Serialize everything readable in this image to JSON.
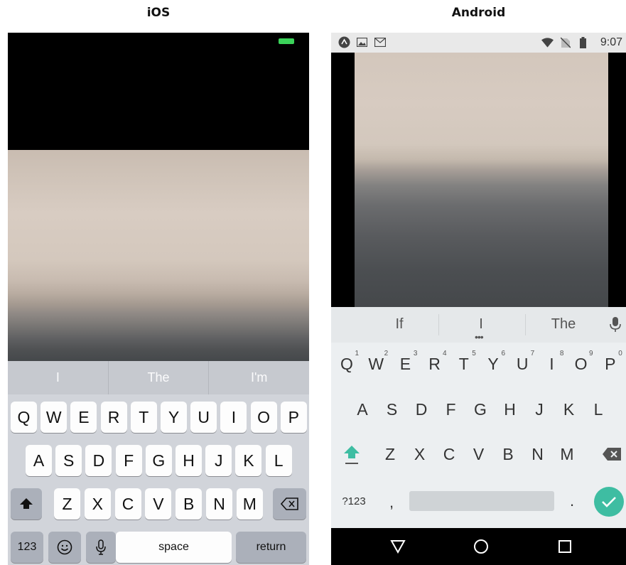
{
  "headings": {
    "ios": "iOS",
    "android": "Android"
  },
  "colors": {
    "ios_battery": "#3bd35a",
    "android_done": "#3ebda2",
    "android_shift": "#3ebda2"
  },
  "ios": {
    "suggestions": [
      "I",
      "The",
      "I'm"
    ],
    "rows": [
      [
        "Q",
        "W",
        "E",
        "R",
        "T",
        "Y",
        "U",
        "I",
        "O",
        "P"
      ],
      [
        "A",
        "S",
        "D",
        "F",
        "G",
        "H",
        "J",
        "K",
        "L"
      ],
      [
        "Z",
        "X",
        "C",
        "V",
        "B",
        "N",
        "M"
      ]
    ],
    "keys": {
      "numbers": "123",
      "space": "space",
      "return": "return",
      "shift_icon": "shift-arrow-icon",
      "delete_icon": "backspace-icon",
      "emoji_icon": "emoji-icon",
      "mic_icon": "microphone-icon"
    }
  },
  "android": {
    "status": {
      "time": "9:07"
    },
    "suggestions": [
      "If",
      "I",
      "The"
    ],
    "suggestion_more": "•••",
    "top_row": [
      "Q",
      "W",
      "E",
      "R",
      "T",
      "Y",
      "U",
      "I",
      "O",
      "P"
    ],
    "top_row_hints": [
      "1",
      "2",
      "3",
      "4",
      "5",
      "6",
      "7",
      "8",
      "9",
      "0"
    ],
    "rows": [
      [
        "A",
        "S",
        "D",
        "F",
        "G",
        "H",
        "J",
        "K",
        "L"
      ],
      [
        "Z",
        "X",
        "C",
        "V",
        "B",
        "N",
        "M"
      ]
    ],
    "keys": {
      "symbols": "?123",
      "comma": ",",
      "period": ".",
      "shift_icon": "shift-arrow-icon",
      "delete_icon": "backspace-icon",
      "done_icon": "check-icon",
      "mic_icon": "microphone-icon"
    },
    "nav": [
      "back-icon",
      "home-icon",
      "recents-icon"
    ]
  }
}
